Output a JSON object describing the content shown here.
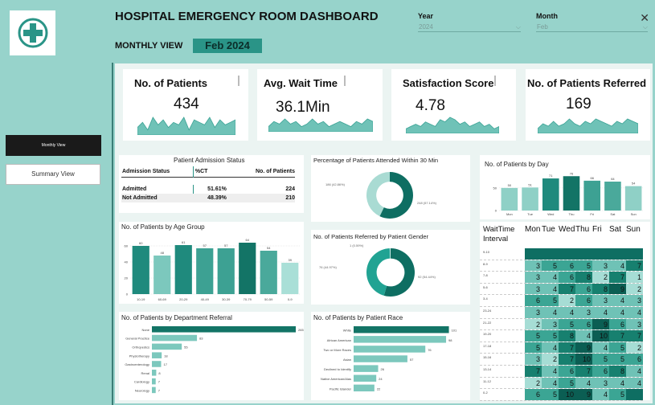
{
  "header": {
    "title": "HOSPITAL EMERGENCY ROOM DASHBOARD",
    "view_label": "MONTHLY VIEW",
    "period": "Feb 2024",
    "year_label": "Year",
    "year_value": "2024",
    "month_label": "Month",
    "month_value": "Feb",
    "close_icon": "close-icon"
  },
  "sidebar": {
    "active_button": "Monthly View",
    "summary_button": "Summary View"
  },
  "kpis": [
    {
      "title": "No. of Patients",
      "value": "434",
      "trend": [
        5,
        7,
        4,
        9,
        6,
        8,
        5,
        7,
        6,
        9,
        4,
        8,
        7,
        6,
        9,
        5,
        8,
        6,
        7,
        8
      ]
    },
    {
      "title": "Avg. Wait Time",
      "value": "36.1Min",
      "trend": [
        6,
        8,
        7,
        9,
        7,
        8,
        6,
        7,
        9,
        7,
        8,
        6,
        7,
        8,
        7,
        6,
        8,
        7,
        9,
        8
      ]
    },
    {
      "title": "Satisfaction Score",
      "value": "4.78",
      "trend": [
        4,
        5,
        6,
        5,
        7,
        6,
        5,
        8,
        7,
        9,
        8,
        6,
        7,
        5,
        6,
        7,
        5,
        6,
        4,
        5
      ]
    },
    {
      "title": "No. of Patients Referred",
      "value": "169",
      "trend": [
        4,
        6,
        5,
        7,
        5,
        6,
        8,
        6,
        5,
        7,
        6,
        8,
        7,
        6,
        5,
        7,
        6,
        8,
        7,
        6
      ]
    }
  ],
  "admission": {
    "title": "Patient Admission Status",
    "headers": [
      "Admission Status",
      "%CT",
      "No. of Patients"
    ],
    "rows": [
      [
        "Admitted",
        "51.61%",
        "224"
      ],
      [
        "Not Admitted",
        "48.39%",
        "210"
      ]
    ]
  },
  "attended": {
    "title": "Percentage of Patients Attended Within 30 Min",
    "label_a": "186 (42.86%)",
    "label_b": "248 (57.14%)",
    "share": 0.5714,
    "colors": [
      "#0e6e62",
      "#a9dbd3"
    ]
  },
  "gender": {
    "title": "No. of Patients Referred by Patient Gender",
    "label_a": "1 (0.59%)",
    "label_b": "76 (44.97%)",
    "label_c": "92 (54.44%)",
    "shares": [
      0.5444,
      0.4497,
      0.0059
    ],
    "colors": [
      "#0e6e62",
      "#21a393",
      "#c9ece7"
    ]
  },
  "chart_data": [
    {
      "type": "bar",
      "title": "No. of Patients by Day",
      "categories": [
        "Mon",
        "Tue",
        "Wed",
        "Thu",
        "Fri",
        "Sat",
        "Sun"
      ],
      "values": [
        50,
        51,
        71,
        76,
        66,
        64,
        54
      ]
    },
    {
      "type": "bar",
      "title": "No. of Patients by Age Group",
      "categories": [
        "10-19",
        "60-69",
        "20-29",
        "40-49",
        "30-39",
        "70-79",
        "50-59",
        "0-9"
      ],
      "values": [
        60,
        48,
        61,
        57,
        57,
        64,
        54,
        39
      ]
    },
    {
      "type": "bar",
      "title": "No. of Patients by Department Referral",
      "orientation": "horizontal",
      "categories": [
        "None",
        "General Practice",
        "Orthopedics",
        "Physiotherapy",
        "Gastroenterology",
        "Renal",
        "Cardiology",
        "Neurology"
      ],
      "values": [
        265,
        83,
        55,
        18,
        17,
        8,
        7,
        7
      ]
    },
    {
      "type": "bar",
      "title": "No. of Patients by Patient Race",
      "orientation": "horizontal",
      "categories": [
        "White",
        "African American",
        "Two or More Races",
        "Asian",
        "Declined to Identify",
        "Native American/Alas",
        "Pacific Islander"
      ],
      "values": [
        101,
        98,
        76,
        57,
        26,
        24,
        22
      ]
    }
  ],
  "heatmap": {
    "corner": "WaitTime Interval",
    "days": [
      "Mon",
      "Tue",
      "Wed",
      "Thu",
      "Fri",
      "Sat",
      "Sun"
    ],
    "rows": [
      {
        "label": "9-10",
        "v": [
          "",
          "",
          "",
          "",
          "",
          "",
          ""
        ]
      },
      {
        "label": "8-9",
        "v": [
          "3",
          "5",
          "6",
          "5",
          "3",
          "4",
          "7"
        ]
      },
      {
        "label": "7-8",
        "v": [
          "3",
          "4",
          "6",
          "8",
          "2",
          "7",
          "1"
        ]
      },
      {
        "label": "5-6",
        "v": [
          "3",
          "4",
          "7",
          "6",
          "8",
          "9",
          "2"
        ]
      },
      {
        "label": "3-4",
        "v": [
          "6",
          "5",
          "2",
          "6",
          "3",
          "4",
          "3"
        ]
      },
      {
        "label": "23-24",
        "v": [
          "3",
          "4",
          "4",
          "3",
          "4",
          "4",
          "4"
        ]
      },
      {
        "label": "21-22",
        "v": [
          "2",
          "3",
          "5",
          "6",
          "9",
          "6",
          "3"
        ]
      },
      {
        "label": "19-20",
        "v": [
          "5",
          "5",
          "8",
          "4",
          "10",
          "7",
          "7"
        ]
      },
      {
        "label": "17-18",
        "v": [
          "5",
          "4",
          "7",
          "9",
          "4",
          "5",
          "2"
        ]
      },
      {
        "label": "15-16",
        "v": [
          "3",
          "2",
          "7",
          "10",
          "5",
          "5",
          "6"
        ]
      },
      {
        "label": "13-14",
        "v": [
          "7",
          "4",
          "6",
          "7",
          "6",
          "8",
          "4"
        ]
      },
      {
        "label": "11-12",
        "v": [
          "2",
          "4",
          "5",
          "4",
          "3",
          "4",
          "4"
        ]
      },
      {
        "label": "0-2",
        "v": [
          "6",
          "5",
          "10",
          "9",
          "4",
          "5",
          ""
        ]
      }
    ]
  }
}
